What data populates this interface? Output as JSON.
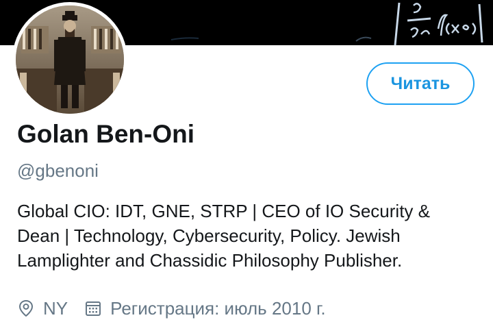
{
  "profile": {
    "display_name": "Golan Ben-Oni",
    "handle": "@gbenoni",
    "bio_lines": [
      "Global CIO: IDT, GNE, STRP | CEO of IO Security &",
      "Dean | Technology, Cybersecurity, Policy. Jewish",
      "Lamplighter and Chassidic Philosophy Publisher."
    ],
    "location": "NY",
    "joined": "Регистрация: июль 2010 г."
  },
  "actions": {
    "follow_label": "Читать"
  },
  "icons": {
    "location": "location-pin-icon",
    "joined": "calendar-icon"
  },
  "colors": {
    "accent": "#1da1f2",
    "secondary_text": "#657786",
    "primary_text": "#14171a",
    "banner": "#000000"
  }
}
